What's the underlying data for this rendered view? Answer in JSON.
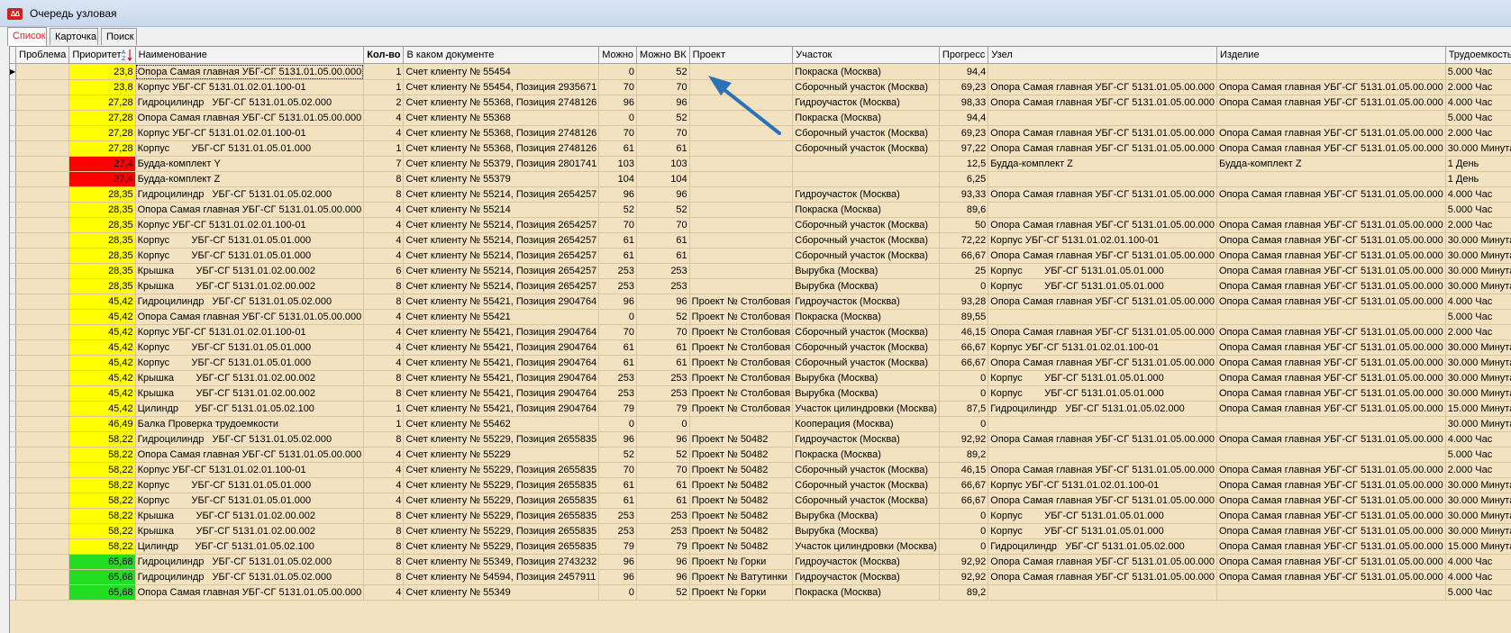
{
  "window": {
    "title": "Очередь узловая"
  },
  "tabs": [
    {
      "label": "Список",
      "active": true
    },
    {
      "label": "Карточка",
      "active": false
    },
    {
      "label": "Поиск",
      "active": false
    }
  ],
  "columns": [
    "Проблема",
    "Приоритет",
    "Наименование",
    "Кол-во",
    "В каком документе",
    "Можно",
    "Можно ВК",
    "Проект",
    "Участок",
    "Прогресс",
    "Узел",
    "Изделие",
    "Трудоемкость"
  ],
  "colors": {
    "yellow": "#ffff00",
    "red": "#ff0000",
    "green": "#22dd22",
    "row_bg": "#f3e2bf",
    "arrow": "#2a73b8"
  },
  "rows": [
    {
      "p": "23,8",
      "c": "yellow",
      "n": "Опора Самая главная УБГ-СГ 5131.01.05.00.000",
      "q": "1",
      "d": "Счет клиенту № 55454",
      "m": "0",
      "mv": "52",
      "pr": "",
      "u": "Покраска (Москва)",
      "g": "94,4",
      "z": "",
      "i": "",
      "t": "5.000 Час"
    },
    {
      "p": "23,8",
      "c": "yellow",
      "n": "Корпус УБГ-СГ 5131.01.02.01.100-01",
      "q": "1",
      "d": "Счет клиенту № 55454, Позиция 2935671",
      "m": "70",
      "mv": "70",
      "pr": "",
      "u": "Сборочный участок (Москва)",
      "g": "69,23",
      "z": "Опора Самая главная УБГ-СГ 5131.01.05.00.000",
      "i": "Опора Самая главная УБГ-СГ 5131.01.05.00.000",
      "t": "2.000 Час"
    },
    {
      "p": "27,28",
      "c": "yellow",
      "n": "Гидроцилиндр   УБГ-СГ 5131.01.05.02.000",
      "q": "2",
      "d": "Счет клиенту № 55368, Позиция 2748126",
      "m": "96",
      "mv": "96",
      "pr": "",
      "u": "Гидроучасток (Москва)",
      "g": "98,33",
      "z": "Опора Самая главная УБГ-СГ 5131.01.05.00.000",
      "i": "Опора Самая главная УБГ-СГ 5131.01.05.00.000",
      "t": "4.000 Час"
    },
    {
      "p": "27,28",
      "c": "yellow",
      "n": "Опора Самая главная УБГ-СГ 5131.01.05.00.000",
      "q": "4",
      "d": "Счет клиенту № 55368",
      "m": "0",
      "mv": "52",
      "pr": "",
      "u": "Покраска (Москва)",
      "g": "94,4",
      "z": "",
      "i": "",
      "t": "5.000 Час"
    },
    {
      "p": "27,28",
      "c": "yellow",
      "n": "Корпус УБГ-СГ 5131.01.02.01.100-01",
      "q": "4",
      "d": "Счет клиенту № 55368, Позиция 2748126",
      "m": "70",
      "mv": "70",
      "pr": "",
      "u": "Сборочный участок (Москва)",
      "g": "69,23",
      "z": "Опора Самая главная УБГ-СГ 5131.01.05.00.000",
      "i": "Опора Самая главная УБГ-СГ 5131.01.05.00.000",
      "t": "2.000 Час"
    },
    {
      "p": "27,28",
      "c": "yellow",
      "n": "Корпус        УБГ-СГ 5131.01.05.01.000",
      "q": "1",
      "d": "Счет клиенту № 55368, Позиция 2748126",
      "m": "61",
      "mv": "61",
      "pr": "",
      "u": "Сборочный участок (Москва)",
      "g": "97,22",
      "z": "Опора Самая главная УБГ-СГ 5131.01.05.00.000",
      "i": "Опора Самая главная УБГ-СГ 5131.01.05.00.000",
      "t": "30.000 Минута"
    },
    {
      "p": "27,4",
      "c": "red",
      "n": "Будда-комплект Y",
      "q": "7",
      "d": "Счет клиенту № 55379, Позиция 2801741",
      "m": "103",
      "mv": "103",
      "pr": "",
      "u": "",
      "g": "12,5",
      "z": "Будда-комплект Z",
      "i": "Будда-комплект Z",
      "t": "1 День"
    },
    {
      "p": "27,4",
      "c": "red",
      "n": "Будда-комплект Z",
      "q": "8",
      "d": "Счет клиенту № 55379",
      "m": "104",
      "mv": "104",
      "pr": "",
      "u": "",
      "g": "6,25",
      "z": "",
      "i": "",
      "t": "1 День"
    },
    {
      "p": "28,35",
      "c": "yellow",
      "n": "Гидроцилиндр   УБГ-СГ 5131.01.05.02.000",
      "q": "8",
      "d": "Счет клиенту № 55214, Позиция 2654257",
      "m": "96",
      "mv": "96",
      "pr": "",
      "u": "Гидроучасток (Москва)",
      "g": "93,33",
      "z": "Опора Самая главная УБГ-СГ 5131.01.05.00.000",
      "i": "Опора Самая главная УБГ-СГ 5131.01.05.00.000",
      "t": "4.000 Час"
    },
    {
      "p": "28,35",
      "c": "yellow",
      "n": "Опора Самая главная УБГ-СГ 5131.01.05.00.000",
      "q": "4",
      "d": "Счет клиенту № 55214",
      "m": "52",
      "mv": "52",
      "pr": "",
      "u": "Покраска (Москва)",
      "g": "89,6",
      "z": "",
      "i": "",
      "t": "5.000 Час"
    },
    {
      "p": "28,35",
      "c": "yellow",
      "n": "Корпус УБГ-СГ 5131.01.02.01.100-01",
      "q": "4",
      "d": "Счет клиенту № 55214, Позиция 2654257",
      "m": "70",
      "mv": "70",
      "pr": "",
      "u": "Сборочный участок (Москва)",
      "g": "50",
      "z": "Опора Самая главная УБГ-СГ 5131.01.05.00.000",
      "i": "Опора Самая главная УБГ-СГ 5131.01.05.00.000",
      "t": "2.000 Час"
    },
    {
      "p": "28,35",
      "c": "yellow",
      "n": "Корпус        УБГ-СГ 5131.01.05.01.000",
      "q": "4",
      "d": "Счет клиенту № 55214, Позиция 2654257",
      "m": "61",
      "mv": "61",
      "pr": "",
      "u": "Сборочный участок (Москва)",
      "g": "72,22",
      "z": "Корпус УБГ-СГ 5131.01.02.01.100-01",
      "i": "Опора Самая главная УБГ-СГ 5131.01.05.00.000",
      "t": "30.000 Минута"
    },
    {
      "p": "28,35",
      "c": "yellow",
      "n": "Корпус        УБГ-СГ 5131.01.05.01.000",
      "q": "4",
      "d": "Счет клиенту № 55214, Позиция 2654257",
      "m": "61",
      "mv": "61",
      "pr": "",
      "u": "Сборочный участок (Москва)",
      "g": "66,67",
      "z": "Опора Самая главная УБГ-СГ 5131.01.05.00.000",
      "i": "Опора Самая главная УБГ-СГ 5131.01.05.00.000",
      "t": "30.000 Минута"
    },
    {
      "p": "28,35",
      "c": "yellow",
      "n": "Крышка        УБГ-СГ 5131.01.02.00.002",
      "q": "6",
      "d": "Счет клиенту № 55214, Позиция 2654257",
      "m": "253",
      "mv": "253",
      "pr": "",
      "u": "Вырубка (Москва)",
      "g": "25",
      "z": "Корпус        УБГ-СГ 5131.01.05.01.000",
      "i": "Опора Самая главная УБГ-СГ 5131.01.05.00.000",
      "t": "30.000 Минута"
    },
    {
      "p": "28,35",
      "c": "yellow",
      "n": "Крышка        УБГ-СГ 5131.01.02.00.002",
      "q": "8",
      "d": "Счет клиенту № 55214, Позиция 2654257",
      "m": "253",
      "mv": "253",
      "pr": "",
      "u": "Вырубка (Москва)",
      "g": "0",
      "z": "Корпус        УБГ-СГ 5131.01.05.01.000",
      "i": "Опора Самая главная УБГ-СГ 5131.01.05.00.000",
      "t": "30.000 Минута"
    },
    {
      "p": "45,42",
      "c": "yellow",
      "n": "Гидроцилиндр   УБГ-СГ 5131.01.05.02.000",
      "q": "8",
      "d": "Счет клиенту № 55421, Позиция 2904764",
      "m": "96",
      "mv": "96",
      "pr": "Проект № Столбовая",
      "u": "Гидроучасток (Москва)",
      "g": "93,28",
      "z": "Опора Самая главная УБГ-СГ 5131.01.05.00.000",
      "i": "Опора Самая главная УБГ-СГ 5131.01.05.00.000",
      "t": "4.000 Час"
    },
    {
      "p": "45,42",
      "c": "yellow",
      "n": "Опора Самая главная УБГ-СГ 5131.01.05.00.000",
      "q": "4",
      "d": "Счет клиенту № 55421",
      "m": "0",
      "mv": "52",
      "pr": "Проект № Столбовая",
      "u": "Покраска (Москва)",
      "g": "89,55",
      "z": "",
      "i": "",
      "t": "5.000 Час"
    },
    {
      "p": "45,42",
      "c": "yellow",
      "n": "Корпус УБГ-СГ 5131.01.02.01.100-01",
      "q": "4",
      "d": "Счет клиенту № 55421, Позиция 2904764",
      "m": "70",
      "mv": "70",
      "pr": "Проект № Столбовая",
      "u": "Сборочный участок (Москва)",
      "g": "46,15",
      "z": "Опора Самая главная УБГ-СГ 5131.01.05.00.000",
      "i": "Опора Самая главная УБГ-СГ 5131.01.05.00.000",
      "t": "2.000 Час"
    },
    {
      "p": "45,42",
      "c": "yellow",
      "n": "Корпус        УБГ-СГ 5131.01.05.01.000",
      "q": "4",
      "d": "Счет клиенту № 55421, Позиция 2904764",
      "m": "61",
      "mv": "61",
      "pr": "Проект № Столбовая",
      "u": "Сборочный участок (Москва)",
      "g": "66,67",
      "z": "Корпус УБГ-СГ 5131.01.02.01.100-01",
      "i": "Опора Самая главная УБГ-СГ 5131.01.05.00.000",
      "t": "30.000 Минута"
    },
    {
      "p": "45,42",
      "c": "yellow",
      "n": "Корпус        УБГ-СГ 5131.01.05.01.000",
      "q": "4",
      "d": "Счет клиенту № 55421, Позиция 2904764",
      "m": "61",
      "mv": "61",
      "pr": "Проект № Столбовая",
      "u": "Сборочный участок (Москва)",
      "g": "66,67",
      "z": "Опора Самая главная УБГ-СГ 5131.01.05.00.000",
      "i": "Опора Самая главная УБГ-СГ 5131.01.05.00.000",
      "t": "30.000 Минута"
    },
    {
      "p": "45,42",
      "c": "yellow",
      "n": "Крышка        УБГ-СГ 5131.01.02.00.002",
      "q": "8",
      "d": "Счет клиенту № 55421, Позиция 2904764",
      "m": "253",
      "mv": "253",
      "pr": "Проект № Столбовая",
      "u": "Вырубка (Москва)",
      "g": "0",
      "z": "Корпус        УБГ-СГ 5131.01.05.01.000",
      "i": "Опора Самая главная УБГ-СГ 5131.01.05.00.000",
      "t": "30.000 Минута"
    },
    {
      "p": "45,42",
      "c": "yellow",
      "n": "Крышка        УБГ-СГ 5131.01.02.00.002",
      "q": "8",
      "d": "Счет клиенту № 55421, Позиция 2904764",
      "m": "253",
      "mv": "253",
      "pr": "Проект № Столбовая",
      "u": "Вырубка (Москва)",
      "g": "0",
      "z": "Корпус        УБГ-СГ 5131.01.05.01.000",
      "i": "Опора Самая главная УБГ-СГ 5131.01.05.00.000",
      "t": "30.000 Минута"
    },
    {
      "p": "45,42",
      "c": "yellow",
      "n": "Цилиндр      УБГ-СГ 5131.01.05.02.100",
      "q": "1",
      "d": "Счет клиенту № 55421, Позиция 2904764",
      "m": "79",
      "mv": "79",
      "pr": "Проект № Столбовая",
      "u": "Участок цилиндровки (Москва)",
      "g": "87,5",
      "z": "Гидроцилиндр   УБГ-СГ 5131.01.05.02.000",
      "i": "Опора Самая главная УБГ-СГ 5131.01.05.00.000",
      "t": "15.000 Минута"
    },
    {
      "p": "46,49",
      "c": "yellow",
      "n": "Балка Проверка трудоемкости",
      "q": "1",
      "d": "Счет клиенту № 55462",
      "m": "0",
      "mv": "0",
      "pr": "",
      "u": "Кооперация (Москва)",
      "g": "0",
      "z": "",
      "i": "",
      "t": "30.000 Минута"
    },
    {
      "p": "58,22",
      "c": "yellow",
      "n": "Гидроцилиндр   УБГ-СГ 5131.01.05.02.000",
      "q": "8",
      "d": "Счет клиенту № 55229, Позиция 2655835",
      "m": "96",
      "mv": "96",
      "pr": "Проект № 50482",
      "u": "Гидроучасток (Москва)",
      "g": "92,92",
      "z": "Опора Самая главная УБГ-СГ 5131.01.05.00.000",
      "i": "Опора Самая главная УБГ-СГ 5131.01.05.00.000",
      "t": "4.000 Час"
    },
    {
      "p": "58,22",
      "c": "yellow",
      "n": "Опора Самая главная УБГ-СГ 5131.01.05.00.000",
      "q": "4",
      "d": "Счет клиенту № 55229",
      "m": "52",
      "mv": "52",
      "pr": "Проект № 50482",
      "u": "Покраска (Москва)",
      "g": "89,2",
      "z": "",
      "i": "",
      "t": "5.000 Час"
    },
    {
      "p": "58,22",
      "c": "yellow",
      "n": "Корпус УБГ-СГ 5131.01.02.01.100-01",
      "q": "4",
      "d": "Счет клиенту № 55229, Позиция 2655835",
      "m": "70",
      "mv": "70",
      "pr": "Проект № 50482",
      "u": "Сборочный участок (Москва)",
      "g": "46,15",
      "z": "Опора Самая главная УБГ-СГ 5131.01.05.00.000",
      "i": "Опора Самая главная УБГ-СГ 5131.01.05.00.000",
      "t": "2.000 Час"
    },
    {
      "p": "58,22",
      "c": "yellow",
      "n": "Корпус        УБГ-СГ 5131.01.05.01.000",
      "q": "4",
      "d": "Счет клиенту № 55229, Позиция 2655835",
      "m": "61",
      "mv": "61",
      "pr": "Проект № 50482",
      "u": "Сборочный участок (Москва)",
      "g": "66,67",
      "z": "Корпус УБГ-СГ 5131.01.02.01.100-01",
      "i": "Опора Самая главная УБГ-СГ 5131.01.05.00.000",
      "t": "30.000 Минута"
    },
    {
      "p": "58,22",
      "c": "yellow",
      "n": "Корпус        УБГ-СГ 5131.01.05.01.000",
      "q": "4",
      "d": "Счет клиенту № 55229, Позиция 2655835",
      "m": "61",
      "mv": "61",
      "pr": "Проект № 50482",
      "u": "Сборочный участок (Москва)",
      "g": "66,67",
      "z": "Опора Самая главная УБГ-СГ 5131.01.05.00.000",
      "i": "Опора Самая главная УБГ-СГ 5131.01.05.00.000",
      "t": "30.000 Минута"
    },
    {
      "p": "58,22",
      "c": "yellow",
      "n": "Крышка        УБГ-СГ 5131.01.02.00.002",
      "q": "8",
      "d": "Счет клиенту № 55229, Позиция 2655835",
      "m": "253",
      "mv": "253",
      "pr": "Проект № 50482",
      "u": "Вырубка (Москва)",
      "g": "0",
      "z": "Корпус        УБГ-СГ 5131.01.05.01.000",
      "i": "Опора Самая главная УБГ-СГ 5131.01.05.00.000",
      "t": "30.000 Минута"
    },
    {
      "p": "58,22",
      "c": "yellow",
      "n": "Крышка        УБГ-СГ 5131.01.02.00.002",
      "q": "8",
      "d": "Счет клиенту № 55229, Позиция 2655835",
      "m": "253",
      "mv": "253",
      "pr": "Проект № 50482",
      "u": "Вырубка (Москва)",
      "g": "0",
      "z": "Корпус        УБГ-СГ 5131.01.05.01.000",
      "i": "Опора Самая главная УБГ-СГ 5131.01.05.00.000",
      "t": "30.000 Минута"
    },
    {
      "p": "58,22",
      "c": "yellow",
      "n": "Цилиндр      УБГ-СГ 5131.01.05.02.100",
      "q": "8",
      "d": "Счет клиенту № 55229, Позиция 2655835",
      "m": "79",
      "mv": "79",
      "pr": "Проект № 50482",
      "u": "Участок цилиндровки (Москва)",
      "g": "0",
      "z": "Гидроцилиндр   УБГ-СГ 5131.01.05.02.000",
      "i": "Опора Самая главная УБГ-СГ 5131.01.05.00.000",
      "t": "15.000 Минута"
    },
    {
      "p": "65,68",
      "c": "green",
      "n": "Гидроцилиндр   УБГ-СГ 5131.01.05.02.000",
      "q": "8",
      "d": "Счет клиенту № 55349, Позиция 2743232",
      "m": "96",
      "mv": "96",
      "pr": "Проект № Горки",
      "u": "Гидроучасток (Москва)",
      "g": "92,92",
      "z": "Опора Самая главная УБГ-СГ 5131.01.05.00.000",
      "i": "Опора Самая главная УБГ-СГ 5131.01.05.00.000",
      "t": "4.000 Час"
    },
    {
      "p": "65,68",
      "c": "green",
      "n": "Гидроцилиндр   УБГ-СГ 5131.01.05.02.000",
      "q": "8",
      "d": "Счет клиенту № 54594, Позиция 2457911",
      "m": "96",
      "mv": "96",
      "pr": "Проект № Ватутинки",
      "u": "Гидроучасток (Москва)",
      "g": "92,92",
      "z": "Опора Самая главная УБГ-СГ 5131.01.05.00.000",
      "i": "Опора Самая главная УБГ-СГ 5131.01.05.00.000",
      "t": "4.000 Час"
    },
    {
      "p": "65,68",
      "c": "green",
      "n": "Опора Самая главная УБГ-СГ 5131.01.05.00.000",
      "q": "4",
      "d": "Счет клиенту № 55349",
      "m": "0",
      "mv": "52",
      "pr": "Проект № Горки",
      "u": "Покраска (Москва)",
      "g": "89,2",
      "z": "",
      "i": "",
      "t": "5.000 Час"
    }
  ]
}
